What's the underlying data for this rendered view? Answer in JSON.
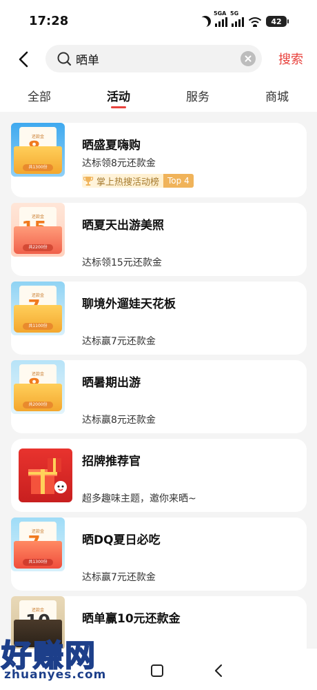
{
  "status": {
    "time": "17:28",
    "battery": "42",
    "signal_tags": [
      "5GA",
      "5G"
    ]
  },
  "search": {
    "query": "晒单",
    "submit_label": "搜索"
  },
  "tabs": [
    {
      "label": "全部"
    },
    {
      "label": "活动"
    },
    {
      "label": "服务"
    },
    {
      "label": "商城"
    }
  ],
  "results": [
    {
      "title": "晒盛夏嗨购",
      "subtitle": "达标领8元还款金",
      "thumb": {
        "label": "还款金",
        "amount": "8",
        "unit": "元",
        "pill": "共1300份"
      },
      "rank": {
        "text": "掌上热搜活动榜",
        "tag": "Top 4"
      }
    },
    {
      "title": "晒夏天出游美照",
      "subtitle": "达标领15元还款金",
      "thumb": {
        "label": "还款金",
        "amount": "15",
        "unit": "元",
        "pill": "共2200份"
      }
    },
    {
      "title": "聊境外遛娃天花板",
      "subtitle": "达标赢7元还款金",
      "thumb": {
        "label": "还款金",
        "amount": "7",
        "unit": "元",
        "pill": "共1100份"
      }
    },
    {
      "title": "晒暑期出游",
      "subtitle": "达标赢8元还款金",
      "thumb": {
        "label": "还款金",
        "amount": "8",
        "unit": "元",
        "pill": "共2000份"
      }
    },
    {
      "title": "招牌推荐官",
      "subtitle": "超多趣味主题，邀你来晒~"
    },
    {
      "title": "晒DQ夏日必吃",
      "subtitle": "达标赢7元还款金",
      "thumb": {
        "label": "还款金",
        "amount": "7",
        "unit": "元",
        "pill": "共1300份"
      }
    },
    {
      "title": "晒单赢10元还款金",
      "thumb": {
        "label": "还款金",
        "amount": "10"
      }
    }
  ],
  "watermark": {
    "big": "好赚网",
    "small": "zhuanyes.com"
  },
  "colors": {
    "accent": "#e8413c",
    "background": "#f4f4f4",
    "gold": "#f07a1f"
  }
}
